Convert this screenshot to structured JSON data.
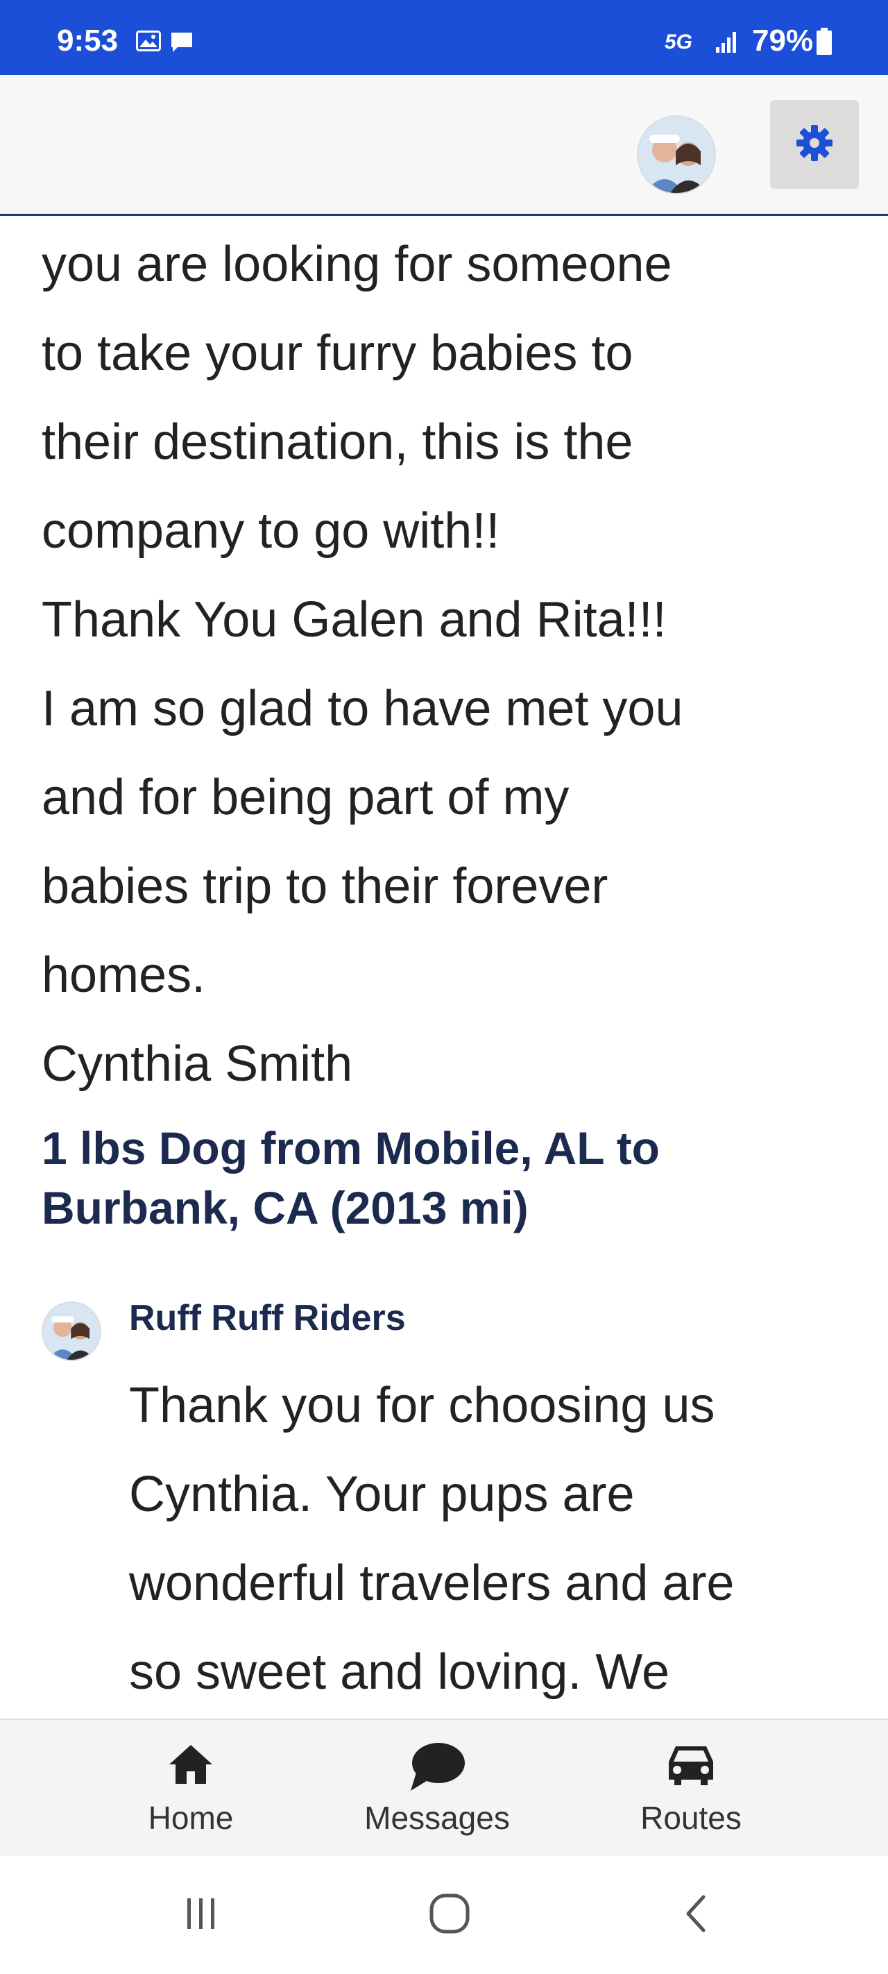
{
  "status_bar": {
    "time": "9:53",
    "network": "5G",
    "battery": "79%",
    "icons": [
      "gallery-icon",
      "message-icon",
      "signal-icon",
      "battery-icon"
    ],
    "background": "#1b4fd8"
  },
  "header": {
    "avatar": "profile-avatar",
    "settings_icon": "gear-icon",
    "accent": "#1b4fd8"
  },
  "review": {
    "lines": [
      "you are looking for someone",
      "to take your furry babies to",
      "their destination, this is the",
      "company to go with!!",
      "Thank You Galen and Rita!!!",
      "I am so glad to have met you",
      "and for being part of my",
      "babies trip to their forever",
      "homes.",
      "Cynthia Smith"
    ]
  },
  "route": {
    "title_line1": "1 lbs Dog from Mobile, AL to",
    "title_line2": "Burbank, CA (2013 mi)"
  },
  "reply": {
    "author": "Ruff Ruff Riders",
    "lines": [
      "Thank you for choosing us",
      "Cynthia. Your pups are",
      "wonderful travelers and are",
      "so sweet and loving. We"
    ]
  },
  "bottom_nav": {
    "items": [
      {
        "label": "Home",
        "icon": "home-icon"
      },
      {
        "label": "Messages",
        "icon": "chat-bubble-icon"
      },
      {
        "label": "Routes",
        "icon": "car-icon"
      }
    ]
  },
  "system_nav": {
    "buttons": [
      "recent-apps-icon",
      "home-circle-icon",
      "back-icon"
    ]
  }
}
